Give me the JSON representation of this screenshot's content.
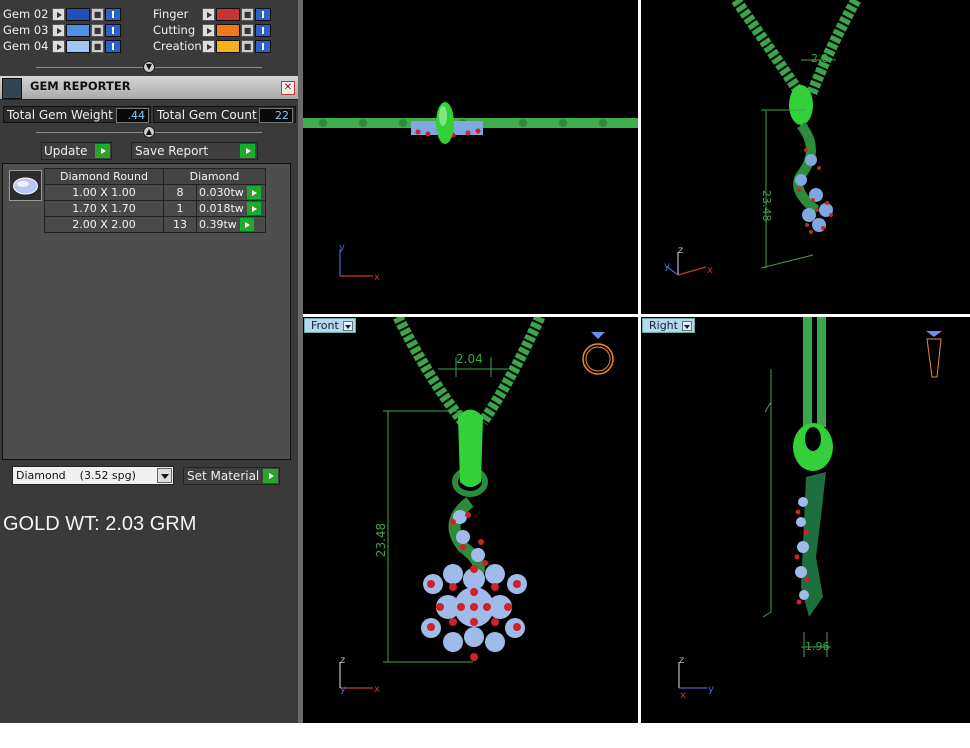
{
  "layers": [
    {
      "name": "Gem 02",
      "color": "#1f4fb8"
    },
    {
      "name": "Gem 03",
      "color": "#4f8fe6"
    },
    {
      "name": "Gem 04",
      "color": "#9fc6f2"
    }
  ],
  "layers_right": [
    {
      "name": "Finger",
      "color": "#c83232"
    },
    {
      "name": "Cutting",
      "color": "#f07a1a"
    },
    {
      "name": "Creation",
      "color": "#f5b21c"
    }
  ],
  "gem_reporter": {
    "title": "GEM REPORTER",
    "total_weight_label": "Total Gem Weight",
    "total_weight_value": ".44",
    "total_count_label": "Total Gem Count",
    "total_count_value": "22",
    "update_label": "Update",
    "save_report_label": "Save Report",
    "headers": [
      "Diamond Round",
      "Diamond"
    ],
    "rows": [
      {
        "size": "1.00 X 1.00",
        "count": "8",
        "weight": "0.030tw"
      },
      {
        "size": "1.70 X 1.70",
        "count": "1",
        "weight": "0.018tw"
      },
      {
        "size": "2.00 X 2.00",
        "count": "13",
        "weight": "0.39tw"
      }
    ]
  },
  "material": {
    "selected": "Diamond    (3.52 spg)",
    "set_label": "Set Material"
  },
  "gold_weight": "GOLD WT: 2.03 GRM",
  "viewports": {
    "front": {
      "tab": "Front",
      "dim_width": "2.04",
      "dim_height": "23.48"
    },
    "right": {
      "tab": "Right",
      "dim_width": "1.96"
    },
    "perspective": {
      "dim_width": "2.0",
      "dim_height": "23.48"
    }
  },
  "axes": {
    "x": "x",
    "y": "y",
    "z": "z"
  }
}
